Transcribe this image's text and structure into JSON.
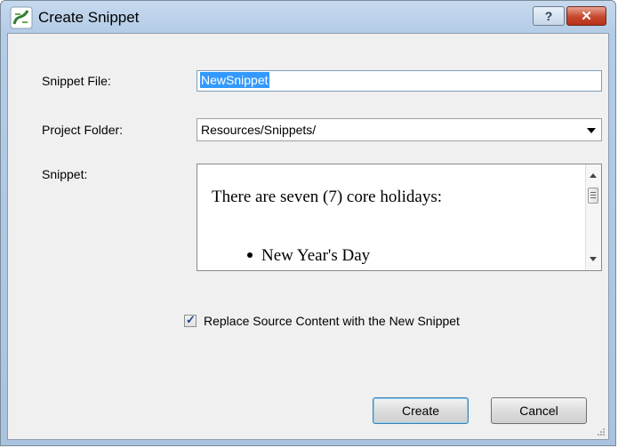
{
  "window": {
    "title": "Create Snippet",
    "help_label": "?",
    "close_label": "✕"
  },
  "form": {
    "snippet_file_label": "Snippet File:",
    "snippet_file_value": "NewSnippet",
    "project_folder_label": "Project Folder:",
    "project_folder_value": "Resources/Snippets/",
    "snippet_label": "Snippet:",
    "snippet_paragraph": "There are seven (7) core holidays:",
    "snippet_bullet": "New Year's Day",
    "replace_checkbox_label": "Replace Source Content with the New Snippet",
    "replace_checked": true
  },
  "buttons": {
    "create": "Create",
    "cancel": "Cancel"
  }
}
